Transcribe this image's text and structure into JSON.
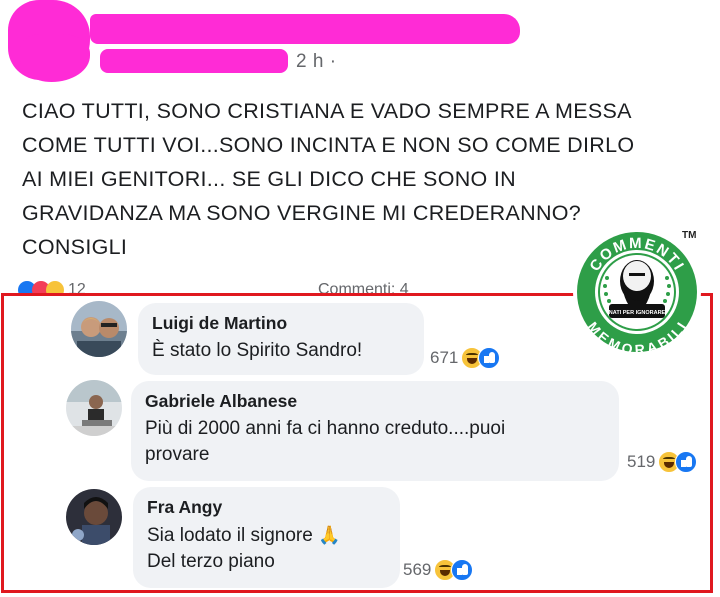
{
  "post": {
    "time": "2 h ·",
    "lines": [
      "CIAO TUTTI, SONO CRISTIANA E VADO SEMPRE A MESSA",
      "COME TUTTI VOI...SONO INCINTA E NON SO COME DIRLO",
      "AI MIEI GENITORI... SE GLI DICO CHE SONO IN",
      "GRAVIDANZA MA SONO VERGINE MI CREDERANNO?",
      "CONSIGLI"
    ],
    "reaction_count": "12",
    "comments_label": "Commenti: 4"
  },
  "comments": [
    {
      "author": "Luigi de Martino",
      "lines": [
        "È stato lo Spirito Sandro!"
      ],
      "reactions": "671"
    },
    {
      "author": "Gabriele Albanese",
      "lines": [
        "Più di 2000 anni fa ci hanno creduto....puoi",
        "provare"
      ],
      "reactions": "519"
    },
    {
      "author": "Fra Angy",
      "lines": [
        "Sia lodato il signore",
        "Del terzo piano"
      ],
      "reactions": "569"
    }
  ],
  "logo": {
    "top_text": "COMMENTI",
    "bottom_text": "MEMORABILI",
    "small_text": "NATI PER IGNORARE",
    "trademark": "TM"
  },
  "colors": {
    "redaction": "#ff2bd6",
    "highlight_frame": "#e0181f",
    "bubble": "#f0f2f5",
    "logo_green": "#2e9e48"
  }
}
